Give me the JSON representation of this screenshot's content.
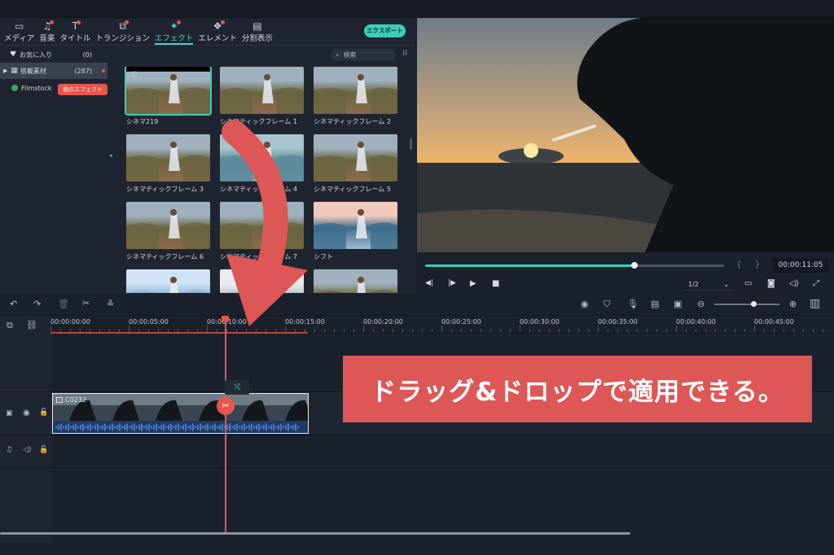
{
  "toolbar": {
    "tabs": [
      {
        "label": "メディア",
        "icon": "folder-icon",
        "dot": false
      },
      {
        "label": "音楽",
        "icon": "music-icon",
        "dot": true
      },
      {
        "label": "タイトル",
        "icon": "title-icon",
        "dot": true
      },
      {
        "label": "トランジション",
        "icon": "transition-icon",
        "dot": true
      },
      {
        "label": "エフェクト",
        "icon": "effect-icon",
        "dot": true,
        "active": true
      },
      {
        "label": "エレメント",
        "icon": "element-icon",
        "dot": true
      },
      {
        "label": "分割表示",
        "icon": "split-screen-icon",
        "dot": false
      }
    ],
    "export_label": "エクスポート"
  },
  "sidebar": {
    "favorites_label": "お気に入り",
    "favorites_count": "(0)",
    "builtin_label": "搭載素材",
    "builtin_count": "(287)",
    "filmstock_label": "Filmstock",
    "filmstock_tooltip": "他のエフェクト"
  },
  "search": {
    "placeholder": "検索"
  },
  "effects": [
    {
      "label": "シネマ219",
      "tone": "warm"
    },
    {
      "label": "シネマティックフレーム 1",
      "tone": "warm"
    },
    {
      "label": "シネマティックフレーム 2",
      "tone": "warm"
    },
    {
      "label": "シネマティックフレーム 3",
      "tone": "warm"
    },
    {
      "label": "シネマティックフレーム 4",
      "tone": "cool"
    },
    {
      "label": "シネマティックフレーム 5",
      "tone": "warm"
    },
    {
      "label": "シネマティックフレーム 6",
      "tone": "warm"
    },
    {
      "label": "シネマティックフレーム 7",
      "tone": "warm"
    },
    {
      "label": "シフト",
      "tone": "shift"
    },
    {
      "label": "",
      "tone": "sky"
    },
    {
      "label": "",
      "tone": "snow"
    },
    {
      "label": "",
      "tone": "warm"
    }
  ],
  "player": {
    "progress": 0.7,
    "timecode": "00:00:11:05",
    "quality": "1/2"
  },
  "timeline": {
    "ruler": [
      "00:00:00:00",
      "00:00:05:00",
      "00:00:10:00",
      "00:00:15:00",
      "00:00:20:00",
      "00:00:25:00",
      "00:00:30:00",
      "00:00:35:00",
      "00:00:40:00",
      "00:00:45:00"
    ],
    "clip_name": "C0232",
    "zoom": 0.6
  },
  "banner_text": "ドラッグ&ドロップで適用できる。",
  "colors": {
    "accent": "#3ad0b7",
    "playhead": "#e8554e",
    "banner": "#dc5755"
  }
}
